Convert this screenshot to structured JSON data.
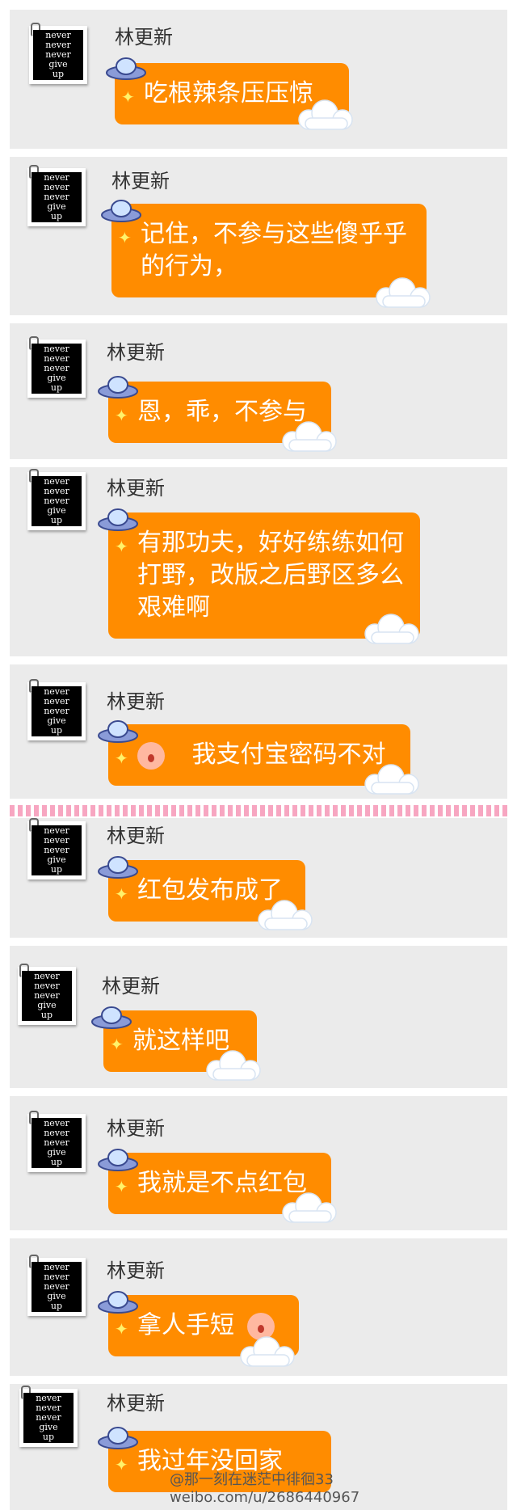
{
  "sender_name": "林更新",
  "avatar_text": [
    "never",
    "never",
    "never",
    "give",
    "up"
  ],
  "messages": [
    {
      "text": "吃根辣条压压惊"
    },
    {
      "text": "记住，不参与这些傻乎乎的行为，"
    },
    {
      "text": "恩，乖，不参与"
    },
    {
      "text": "有那功夫，好好练练如何打野，改版之后野区多么艰难啊"
    },
    {
      "text": "我支付宝密码不对",
      "emoji": "shocked-face-icon"
    },
    {
      "text": "红包发布成了"
    },
    {
      "text": "就这样吧"
    },
    {
      "text": "我就是不点红包"
    },
    {
      "text": "拿人手短",
      "emoji": "grinning-face-icon"
    },
    {
      "text": "我过年没回家"
    }
  ],
  "watermark": {
    "line1": "@那一刻在迷茫中徘徊33",
    "line2": "weibo.com/u/2686440967"
  },
  "colors": {
    "bubble": "#ff8c00",
    "card": "#ebebeb",
    "divider": "#f7a6c1"
  }
}
